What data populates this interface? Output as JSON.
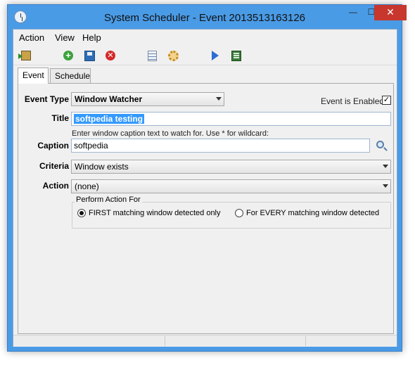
{
  "window": {
    "title": "System Scheduler - Event 2013513163126",
    "min_glyph": "—",
    "max_glyph": "☐",
    "close_glyph": "✕"
  },
  "menu": [
    {
      "label": "Action"
    },
    {
      "label": "View"
    },
    {
      "label": "Help"
    }
  ],
  "toolbar": {
    "icons": [
      "exit-icon",
      "add-icon",
      "save-icon",
      "delete-icon",
      "list-icon",
      "settings-gear-icon",
      "run-play-icon",
      "run-now-icon"
    ]
  },
  "tabs": [
    {
      "label": "Event",
      "active": true
    },
    {
      "label": "Schedule",
      "active": false
    }
  ],
  "form": {
    "event_type_label": "Event Type",
    "event_type_value": "Window Watcher",
    "enabled_label": "Event is Enabled",
    "enabled_checked": true,
    "enabled_glyph": "✓",
    "title_label": "Title",
    "title_value": "softpedia testing",
    "caption_hint": "Enter window caption text to watch for. Use * for wildcard:",
    "caption_label": "Caption",
    "caption_value": "softpedia",
    "criteria_label": "Criteria",
    "criteria_value": "Window exists",
    "action_label": "Action",
    "action_value": "(none)",
    "perform_group_title": "Perform Action For",
    "radio_first": "FIRST matching window detected only",
    "radio_every": "For EVERY matching window detected",
    "radio_selected": "first"
  }
}
